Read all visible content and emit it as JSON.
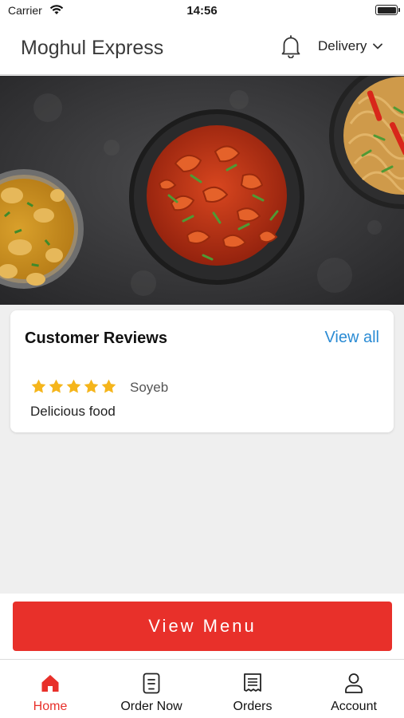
{
  "status_bar": {
    "carrier": "Carrier",
    "time": "14:56"
  },
  "header": {
    "title": "Moghul Express",
    "delivery_label": "Delivery",
    "icons": {
      "bell": "bell-icon",
      "chevron": "chevron-down-icon"
    }
  },
  "hero": {
    "icon": "food-photo"
  },
  "reviews": {
    "title": "Customer Reviews",
    "view_all": "View all",
    "items": [
      {
        "rating": 5,
        "reviewer": "Soyeb",
        "text": "Delicious food"
      }
    ]
  },
  "cta": {
    "label": "View Menu"
  },
  "tabs": [
    {
      "label": "Home",
      "icon": "home-icon",
      "active": true
    },
    {
      "label": "Order Now",
      "icon": "order-icon",
      "active": false
    },
    {
      "label": "Orders",
      "icon": "receipt-icon",
      "active": false
    },
    {
      "label": "Account",
      "icon": "user-icon",
      "active": false
    }
  ],
  "colors": {
    "accent": "#e8302a",
    "link": "#2a8bd4",
    "star": "#f5b51b",
    "background": "#efefef"
  }
}
